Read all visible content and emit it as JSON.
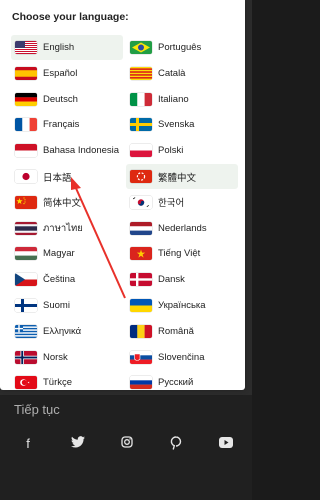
{
  "panel": {
    "title": "Choose your language:"
  },
  "background": {
    "snippet": "Tiếp tục"
  },
  "languages": [
    {
      "label": "English",
      "flag": "flag-us-icon",
      "selected": true
    },
    {
      "label": "Português",
      "flag": "flag-br-icon"
    },
    {
      "label": "Español",
      "flag": "flag-es-icon"
    },
    {
      "label": "Català",
      "flag": "flag-catalonia-icon"
    },
    {
      "label": "Deutsch",
      "flag": "flag-de-icon"
    },
    {
      "label": "Italiano",
      "flag": "flag-it-icon"
    },
    {
      "label": "Français",
      "flag": "flag-fr-icon"
    },
    {
      "label": "Svenska",
      "flag": "flag-se-icon"
    },
    {
      "label": "Bahasa Indonesia",
      "flag": "flag-id-icon"
    },
    {
      "label": "Polski",
      "flag": "flag-pl-icon"
    },
    {
      "label": "日本語",
      "flag": "flag-jp-icon"
    },
    {
      "label": "繁體中文",
      "flag": "flag-hk-icon",
      "selected": true
    },
    {
      "label": "简体中文",
      "flag": "flag-cn-icon"
    },
    {
      "label": "한국어",
      "flag": "flag-kr-icon"
    },
    {
      "label": "ภาษาไทย",
      "flag": "flag-th-icon"
    },
    {
      "label": "Nederlands",
      "flag": "flag-nl-icon"
    },
    {
      "label": "Magyar",
      "flag": "flag-hu-icon"
    },
    {
      "label": "Tiếng Việt",
      "flag": "flag-vn-icon"
    },
    {
      "label": "Čeština",
      "flag": "flag-cz-icon"
    },
    {
      "label": "Dansk",
      "flag": "flag-dk-icon"
    },
    {
      "label": "Suomi",
      "flag": "flag-fi-icon"
    },
    {
      "label": "Українська",
      "flag": "flag-ua-icon"
    },
    {
      "label": "Ελληνικά",
      "flag": "flag-gr-icon"
    },
    {
      "label": "Română",
      "flag": "flag-ro-icon"
    },
    {
      "label": "Norsk",
      "flag": "flag-no-icon"
    },
    {
      "label": "Slovenčina",
      "flag": "flag-sk-icon"
    },
    {
      "label": "Türkçe",
      "flag": "flag-tr-icon"
    },
    {
      "label": "Русский",
      "flag": "flag-ru-icon"
    }
  ],
  "social": [
    {
      "name": "facebook-icon",
      "glyph": "f"
    },
    {
      "name": "twitter-icon",
      "glyph": "🐦"
    },
    {
      "name": "instagram-icon",
      "glyph": "◎"
    },
    {
      "name": "pinterest-icon",
      "glyph": "P"
    },
    {
      "name": "youtube-icon",
      "glyph": "▶"
    }
  ],
  "colors": {
    "selected_bg": "#eef3ee",
    "annotation": "#e8312a"
  }
}
